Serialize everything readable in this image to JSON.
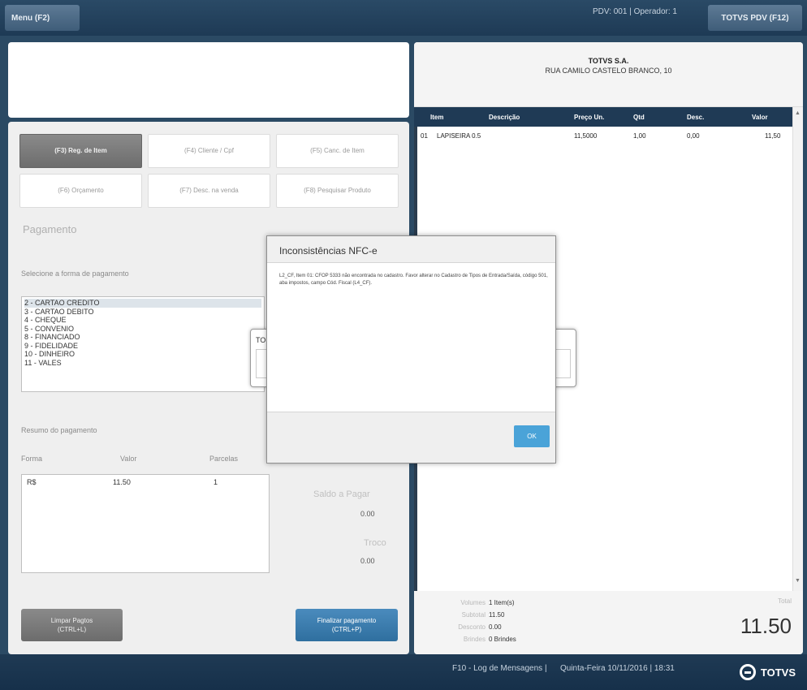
{
  "header": {
    "menu_label": "Menu (F2)",
    "info": "PDV: 001  |  Operador: 1",
    "pdv_label": "TOTVS PDV (F12)"
  },
  "function_buttons": [
    {
      "label": "(F3) Reg. de Item"
    },
    {
      "label": "(F4) Cliente / Cpf"
    },
    {
      "label": "(F5) Canc. de Item"
    },
    {
      "label": "(F6) Orçamento"
    },
    {
      "label": "(F7) Desc. na venda"
    },
    {
      "label": "(F8) Pesquisar Produto"
    }
  ],
  "payment": {
    "title": "Pagamento",
    "select_label": "Selecione a forma de pagamento",
    "options": [
      "2 - CARTAO CREDITO",
      "3 - CARTAO DEBITO",
      "4 - CHEQUE",
      "5 - CONVENIO",
      "8 - FINANCIADO",
      "9 - FIDELIDADE",
      "10 - DINHEIRO",
      "11 - VALES"
    ],
    "summary_title": "Resumo do pagamento",
    "col_forma": "Forma",
    "col_valor": "Valor",
    "col_parcelas": "Parcelas",
    "row": {
      "forma": "R$",
      "valor": "11.50",
      "parcelas": "1"
    },
    "saldo_label": "Saldo a Pagar",
    "saldo_value": "0.00",
    "troco_label": "Troco",
    "troco_value": "0.00",
    "clear_line1": "Limpar Pagtos",
    "clear_line2": "(CTRL+L)",
    "finish_line1": "Finalizar pagamento",
    "finish_line2": "(CTRL+P)"
  },
  "company": {
    "name": "TOTVS S.A.",
    "address": "RUA CAMILO CASTELO BRANCO, 10"
  },
  "items": {
    "headers": [
      "Item",
      "Descrição",
      "Preço Un.",
      "Qtd",
      "Desc.",
      "Valor"
    ],
    "rows": [
      {
        "item": "01",
        "desc": "LAPISEIRA 0.5",
        "preco": "11,5000",
        "qtd": "1,00",
        "descv": "0,00",
        "valor": "11,50"
      }
    ]
  },
  "totals": {
    "volumes_label": "Volumes",
    "volumes_value": "1 Item(s)",
    "subtotal_label": "Subtotal",
    "subtotal_value": "11.50",
    "desconto_label": "Desconto",
    "desconto_value": "0.00",
    "brindes_label": "Brindes",
    "brindes_value": "0 Brindes",
    "total_label": "Total",
    "total_value": "11.50"
  },
  "back_dialog_title": "TO",
  "modal": {
    "title": "Inconsistências NFC-e",
    "message": "L2_CF, Item 01: CFOP 5333 não encontrada no cadastro. Favor alterar no Cadastro de Tipos de Entrada/Saída, código 501, aba impostos, campo Cód. Fiscal (L4_CF).",
    "ok_label": "OK"
  },
  "footer": {
    "log": "F10 - Log de Mensagens  |",
    "datetime": "Quinta-Feira 10/11/2016 | 18:31",
    "brand": "TOTVS"
  }
}
